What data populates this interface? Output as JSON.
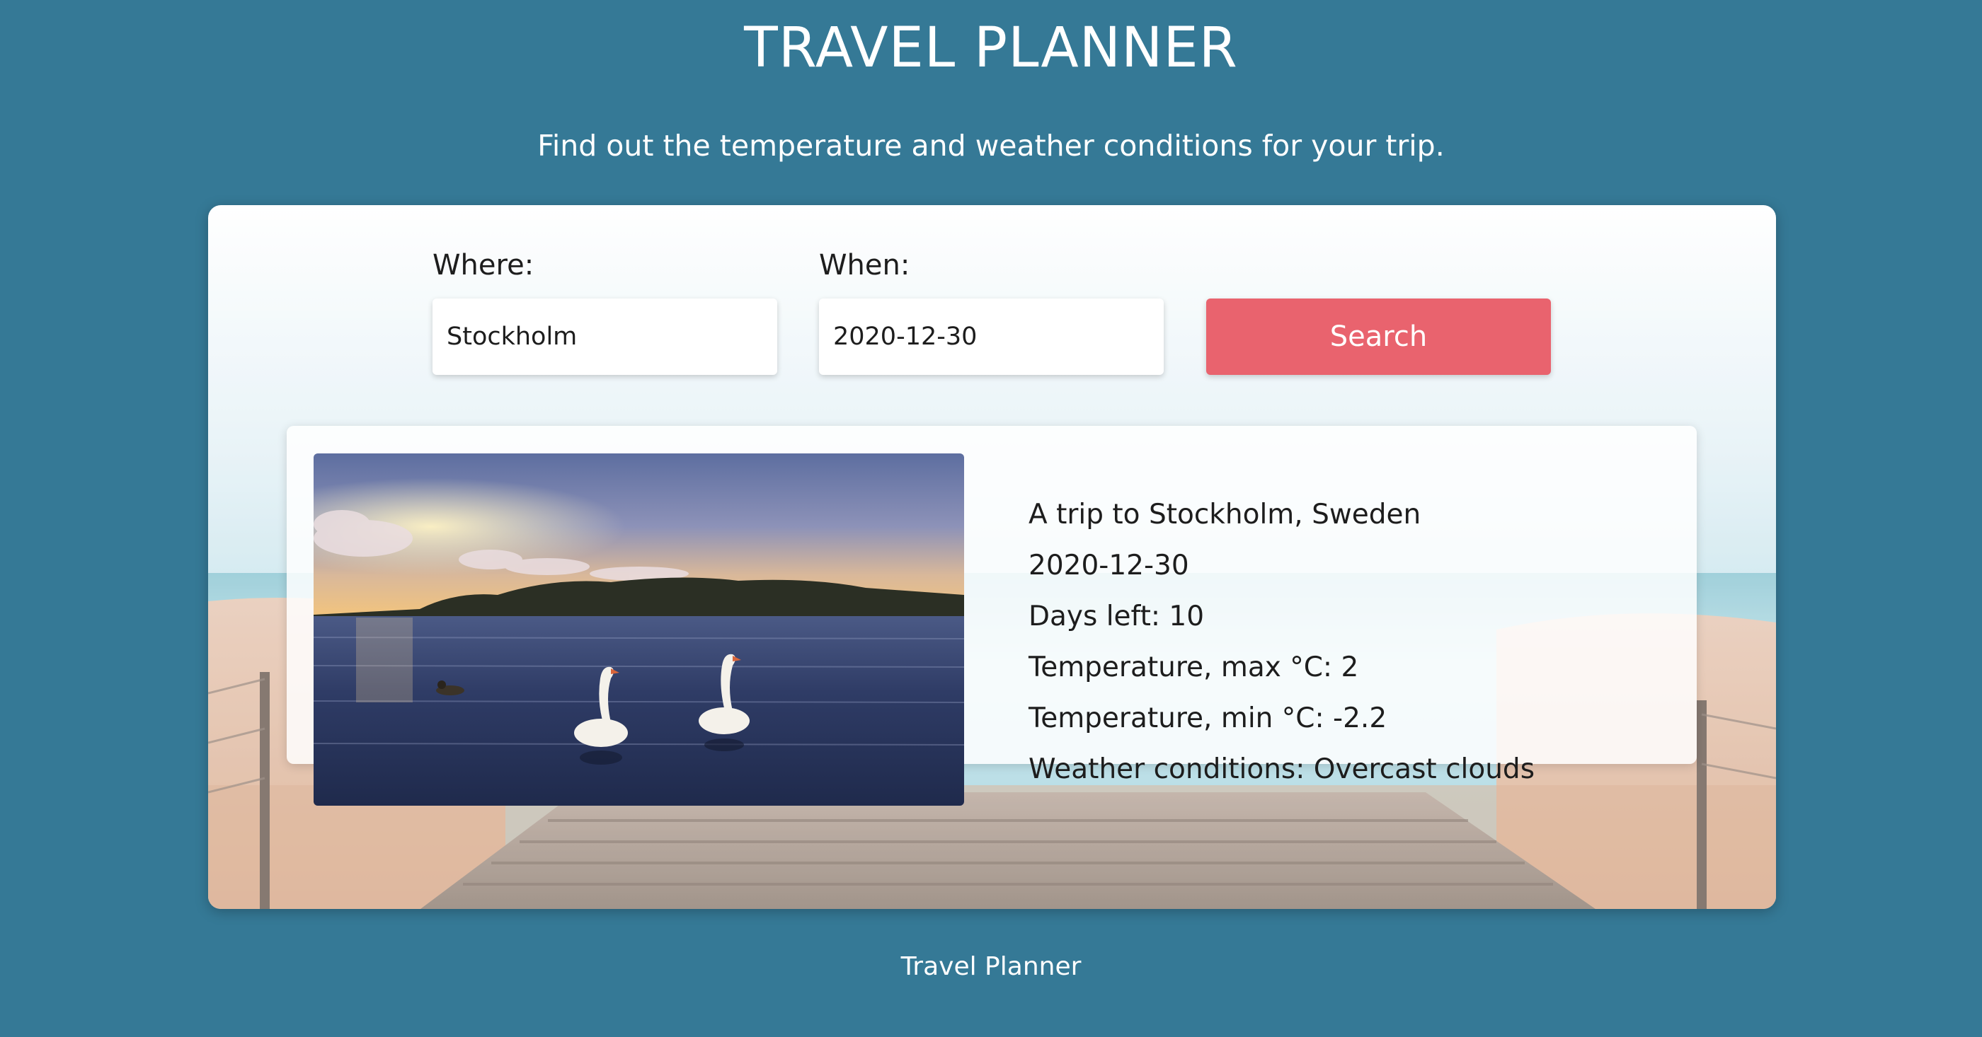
{
  "header": {
    "title": "TRAVEL PLANNER",
    "subtitle": "Find out the temperature and weather conditions for your trip."
  },
  "search_form": {
    "where_label": "Where:",
    "where_value": "Stockholm",
    "when_label": "When:",
    "when_value": "2020-12-30",
    "search_button_label": "Search"
  },
  "result": {
    "trip_title": "A trip to Stockholm, Sweden",
    "date": "2020-12-30",
    "days_left": "Days left: 10",
    "temp_max": "Temperature, max °C: 2",
    "temp_min": "Temperature, min °C: -2.2",
    "conditions": "Weather conditions: Overcast clouds"
  },
  "footer": {
    "text": "Travel Planner"
  },
  "colors": {
    "page_background": "#357996",
    "search_button": "#e9636e"
  }
}
